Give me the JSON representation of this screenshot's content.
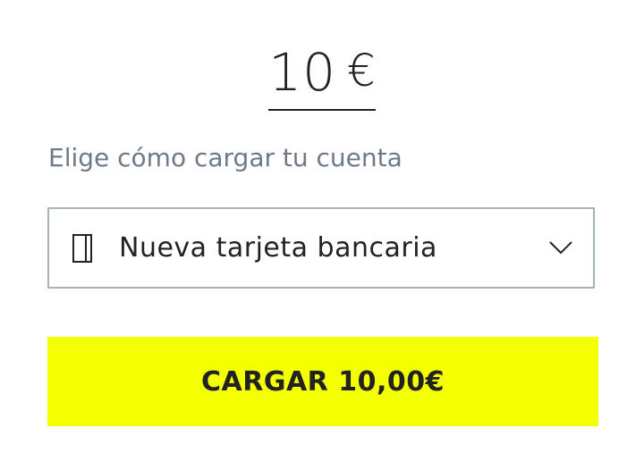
{
  "amount": {
    "value": "10",
    "currency": "€"
  },
  "section": {
    "label": "Elige cómo cargar tu cuenta"
  },
  "payment_method": {
    "icon": "credit-card-icon",
    "selected": "Nueva tarjeta bancaria",
    "dropdown_icon": "chevron-down-icon"
  },
  "submit": {
    "label": "CARGAR 10,00€"
  },
  "colors": {
    "accent": "#f4ff00",
    "text": "#222222",
    "label": "#6e7a8a",
    "border": "#a8b3bf"
  }
}
